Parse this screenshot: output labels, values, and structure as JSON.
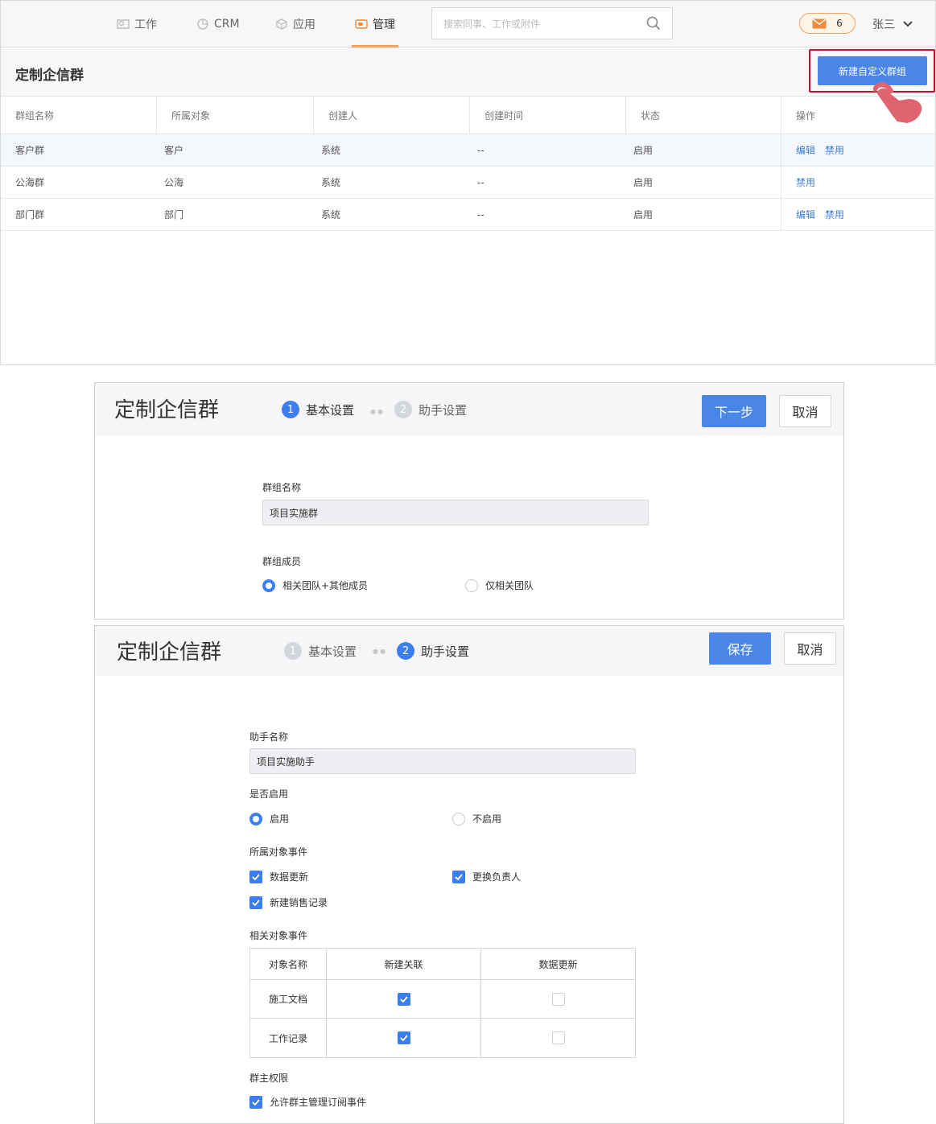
{
  "nav": {
    "items": [
      {
        "label": "工作",
        "icon": "chart-icon"
      },
      {
        "label": "CRM",
        "icon": "pie-icon"
      },
      {
        "label": "应用",
        "icon": "cube-icon"
      },
      {
        "label": "管理",
        "icon": "toggle-icon",
        "active": true
      }
    ],
    "search_placeholder": "搜索同事、工作或附件",
    "message_count": "6",
    "user_name": "张三"
  },
  "list_page": {
    "title": "定制企信群",
    "new_button": "新建自定义群组",
    "columns": [
      "群组名称",
      "所属对象",
      "创建人",
      "创建时间",
      "状态",
      "操作"
    ],
    "rows": [
      {
        "name": "客户群",
        "object": "客户",
        "creator": "系统",
        "time": "--",
        "status": "启用",
        "actions": [
          "编辑",
          "禁用"
        ]
      },
      {
        "name": "公海群",
        "object": "公海",
        "creator": "系统",
        "time": "--",
        "status": "启用",
        "actions": [
          "禁用"
        ]
      },
      {
        "name": "部门群",
        "object": "部门",
        "creator": "系统",
        "time": "--",
        "status": "启用",
        "actions": [
          "编辑",
          "禁用"
        ]
      }
    ]
  },
  "step1": {
    "title": "定制企信群",
    "steps": [
      {
        "num": "1",
        "label": "基本设置"
      },
      {
        "num": "2",
        "label": "助手设置"
      }
    ],
    "next_button": "下一步",
    "cancel_button": "取消",
    "group_name_label": "群组名称",
    "group_name_value": "项目实施群",
    "members_label": "群组成员",
    "members_options": [
      "相关团队+其他成员",
      "仅相关团队"
    ]
  },
  "step2": {
    "title": "定制企信群",
    "steps": [
      {
        "num": "1",
        "label": "基本设置"
      },
      {
        "num": "2",
        "label": "助手设置"
      }
    ],
    "save_button": "保存",
    "cancel_button": "取消",
    "assistant_name_label": "助手名称",
    "assistant_name_value": "项目实施助手",
    "enable_label": "是否启用",
    "enable_options": [
      "启用",
      "不启用"
    ],
    "object_events_label": "所属对象事件",
    "object_events": [
      "数据更新",
      "更换负责人",
      "新建销售记录"
    ],
    "related_events_label": "相关对象事件",
    "related_columns": [
      "对象名称",
      "新建关联",
      "数据更新"
    ],
    "related_rows": [
      {
        "name": "施工文档",
        "new_link": true,
        "data_update": false
      },
      {
        "name": "工作记录",
        "new_link": true,
        "data_update": false
      }
    ],
    "owner_perm_label": "群主权限",
    "owner_perm_option": "允许群主管理订阅事件"
  }
}
